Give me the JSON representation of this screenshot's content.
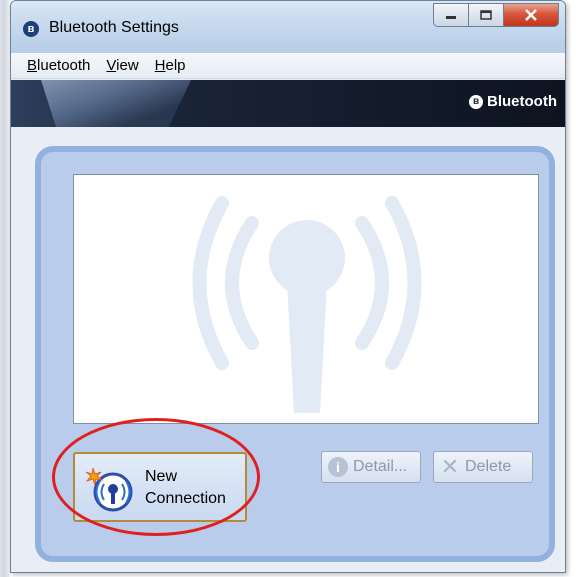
{
  "window": {
    "title": "Bluetooth Settings",
    "title_icon": "bluetooth-icon",
    "controls": {
      "minimize": "minimize-icon",
      "maximize": "maximize-icon",
      "close": "close-icon"
    }
  },
  "menu": {
    "items": [
      {
        "underline": "B",
        "rest": "luetooth"
      },
      {
        "underline": "V",
        "rest": "iew"
      },
      {
        "underline": "H",
        "rest": "elp"
      }
    ]
  },
  "banner": {
    "brand": "Bluetooth"
  },
  "main": {
    "new_connection": {
      "line1": "New",
      "line2": "Connection"
    },
    "detail_label": "Detail...",
    "delete_label": "Delete"
  },
  "colors": {
    "accent": "#93b0de",
    "highlight": "#e0201e",
    "panel": "#b9ccec"
  }
}
